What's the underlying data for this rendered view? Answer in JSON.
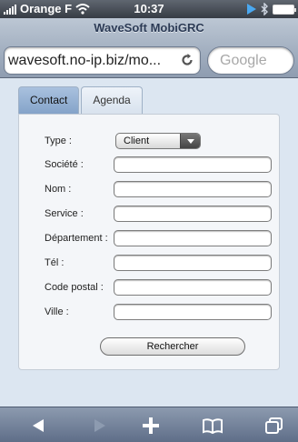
{
  "status_bar": {
    "carrier": "Orange F",
    "time": "10:37"
  },
  "browser": {
    "page_title": "WaveSoft MobiGRC",
    "url": "wavesoft.no-ip.biz/mo...",
    "search_placeholder": "Google"
  },
  "tabs": [
    {
      "label": "Contact",
      "active": true
    },
    {
      "label": "Agenda",
      "active": false
    }
  ],
  "form": {
    "type_label": "Type :",
    "type_value": "Client",
    "fields": [
      {
        "label": "Société :",
        "value": ""
      },
      {
        "label": "Nom :",
        "value": ""
      },
      {
        "label": "Service :",
        "value": ""
      },
      {
        "label": "Département :",
        "value": ""
      },
      {
        "label": "Tél :",
        "value": ""
      },
      {
        "label": "Code postal :",
        "value": ""
      },
      {
        "label": "Ville :",
        "value": ""
      }
    ],
    "submit_label": "Rechercher"
  },
  "toolbar": {
    "icons": [
      "back-arrow-icon",
      "forward-arrow-icon",
      "plus-icon",
      "bookmarks-book-icon",
      "pages-icon"
    ]
  },
  "colors": {
    "battery": "#4fd04a",
    "active_tab": "#9ab5d8",
    "toolbar": "#6f7e97"
  }
}
